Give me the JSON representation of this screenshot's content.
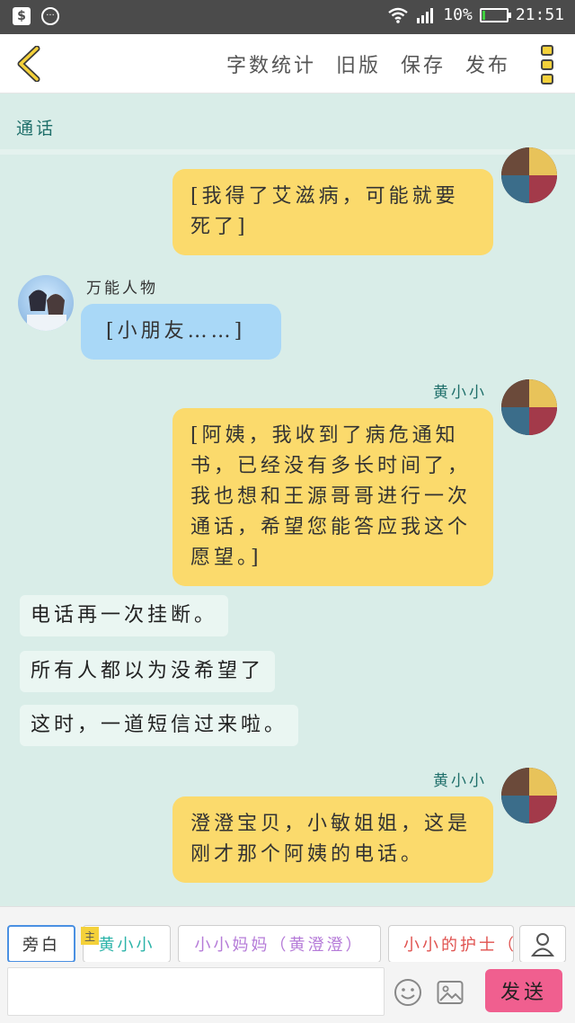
{
  "status_bar": {
    "battery": "10%",
    "battery_level": 0.1,
    "time": "21:51"
  },
  "nav": {
    "actions": [
      "字数统计",
      "旧版",
      "保存",
      "发布"
    ]
  },
  "chat": {
    "call_label": "通话",
    "messages": [
      {
        "side": "right",
        "text": "[我得了艾滋病，可能就要死了]"
      },
      {
        "side": "left",
        "name": "万能人物",
        "text": "[小朋友……]"
      },
      {
        "side": "right",
        "name": "黄小小",
        "text": "[阿姨，我收到了病危通知书，已经没有多长时间了，我也想和王源哥哥进行一次通话，希望您能答应我这个愿望。]"
      },
      {
        "side": "narration",
        "text": "电话再一次挂断。"
      },
      {
        "side": "narration",
        "text": "所有人都以为没希望了"
      },
      {
        "side": "narration",
        "text": "这时，一道短信过来啦。"
      },
      {
        "side": "right",
        "name": "黄小小",
        "text": "澄澄宝贝，小敏姐姐，这是刚才那个阿姨的电话。"
      }
    ]
  },
  "roles": {
    "tag": "主",
    "items": [
      {
        "label": "旁白",
        "color": "#333333"
      },
      {
        "label": "黄小小",
        "color": "#2bb3a8"
      },
      {
        "label": "小小妈妈（黄澄澄）",
        "color": "#b57bd8"
      },
      {
        "label": "小小的护士（",
        "color": "#e0524f"
      }
    ]
  },
  "input": {
    "placeholder": "",
    "send_label": "发送"
  }
}
